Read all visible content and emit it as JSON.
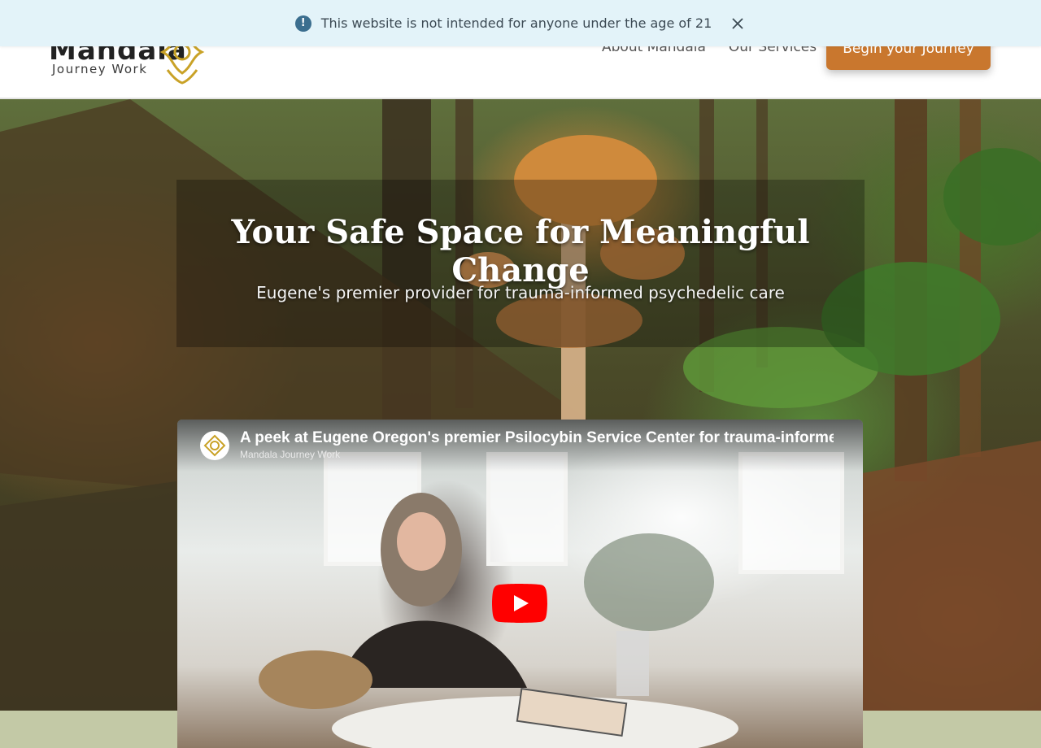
{
  "notice": {
    "icon": "exclamation-circle-icon",
    "icon_glyph": "!",
    "text": "This website is not intended for anyone under the age of 21",
    "close_icon": "close-icon"
  },
  "header": {
    "logo": {
      "name": "Mandala",
      "sub": "Journey Work",
      "mark_icon": "mandala-logo-icon"
    },
    "nav": [
      {
        "label": "About Mandala"
      },
      {
        "label": "Our Services"
      }
    ],
    "cta": {
      "label": "Begin your Journey"
    }
  },
  "hero": {
    "title": "Your Safe Space for Meaningful Change",
    "subtitle": "Eugene's premier provider for trauma-informed psychedelic care"
  },
  "video": {
    "title": "A peek at Eugene Oregon's premier Psilocybin Service Center for trauma-informed",
    "channel": "Mandala Journey Work",
    "play_icon": "play-icon"
  },
  "colors": {
    "notice_bg": "#e3f3f9",
    "cta_bg": "#c9772e",
    "band": "#c3c9a6",
    "youtube_red": "#ff0000"
  }
}
